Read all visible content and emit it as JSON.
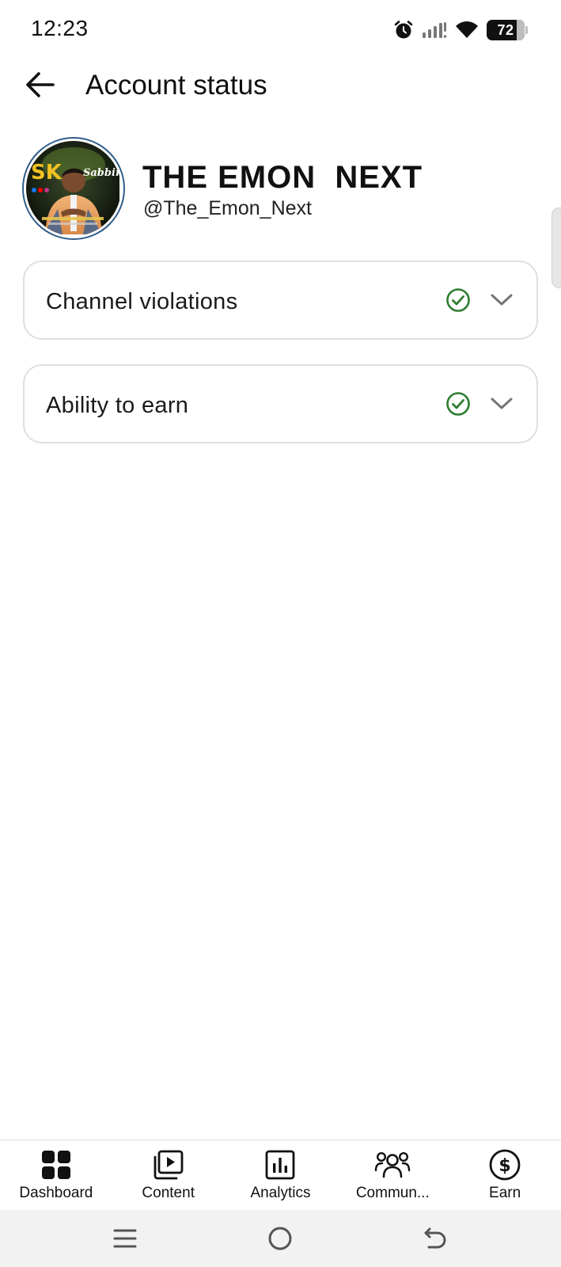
{
  "status_bar": {
    "time": "12:23",
    "battery": "72",
    "icons": [
      "alarm-icon",
      "cellular-signal-icon",
      "wifi-icon",
      "battery-icon"
    ]
  },
  "app_bar": {
    "title": "Account status",
    "back_icon": "arrow-left-icon"
  },
  "channel": {
    "name": "THE EMON  NEXT",
    "handle": "@The_Emon_Next",
    "avatar_text": "SK Sabbir"
  },
  "cards": [
    {
      "label": "Channel violations",
      "status_icon": "check-circle-icon",
      "status_color": "#2e7d32",
      "expand_icon": "chevron-down-icon"
    },
    {
      "label": "Ability to earn",
      "status_icon": "check-circle-icon",
      "status_color": "#2e7d32",
      "expand_icon": "chevron-down-icon"
    }
  ],
  "bottom_nav": {
    "items": [
      {
        "label": "Dashboard",
        "icon": "dashboard-icon",
        "selected": true
      },
      {
        "label": "Content",
        "icon": "content-icon"
      },
      {
        "label": "Analytics",
        "icon": "analytics-icon"
      },
      {
        "label": "Commun...",
        "icon": "community-icon"
      },
      {
        "label": "Earn",
        "icon": "earn-icon"
      }
    ]
  },
  "system_nav": {
    "icons": [
      "recent-apps-icon",
      "home-icon",
      "back-icon"
    ]
  }
}
